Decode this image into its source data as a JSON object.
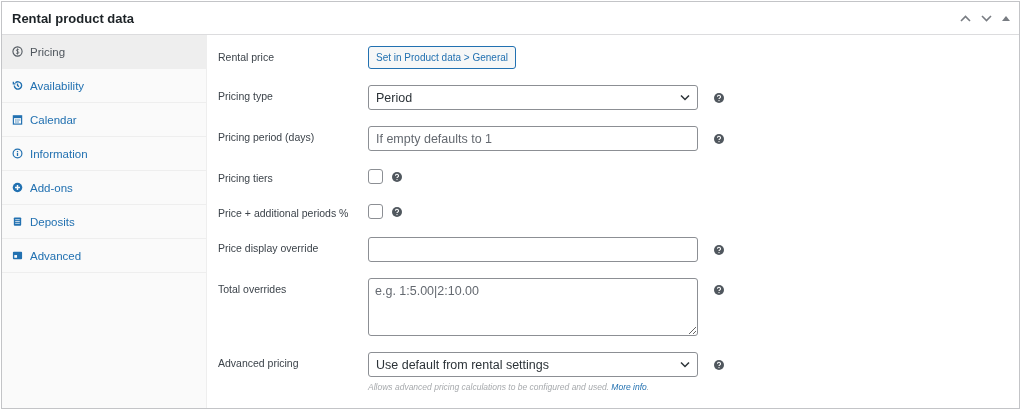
{
  "panel": {
    "title": "Rental product data"
  },
  "tabs": [
    {
      "label": "Pricing",
      "selected": true
    },
    {
      "label": "Availability",
      "selected": false
    },
    {
      "label": "Calendar",
      "selected": false
    },
    {
      "label": "Information",
      "selected": false
    },
    {
      "label": "Add-ons",
      "selected": false
    },
    {
      "label": "Deposits",
      "selected": false
    },
    {
      "label": "Advanced",
      "selected": false
    }
  ],
  "fields": [
    {
      "kind": "button",
      "label": "Rental price",
      "value": "Set in Product data > General",
      "help": false
    },
    {
      "kind": "select",
      "label": "Pricing type",
      "value": "Period",
      "help": true
    },
    {
      "kind": "input",
      "label": "Pricing period (days)",
      "placeholder": "If empty defaults to 1",
      "help": true
    },
    {
      "kind": "checkbox",
      "label": "Pricing tiers",
      "checked": false,
      "help": true
    },
    {
      "kind": "checkbox",
      "label": "Price + additional periods %",
      "checked": false,
      "help": true
    },
    {
      "kind": "input",
      "label": "Price display override",
      "help": true
    },
    {
      "kind": "textarea",
      "label": "Total overrides",
      "placeholder": "e.g. 1:5.00|2:10.00",
      "help": true
    },
    {
      "kind": "select",
      "label": "Advanced pricing",
      "value": "Use default from rental settings",
      "help": true,
      "description": {
        "text": "Allows advanced pricing calculations to be configured and used.",
        "link": "More info",
        "suffix": "."
      }
    }
  ]
}
